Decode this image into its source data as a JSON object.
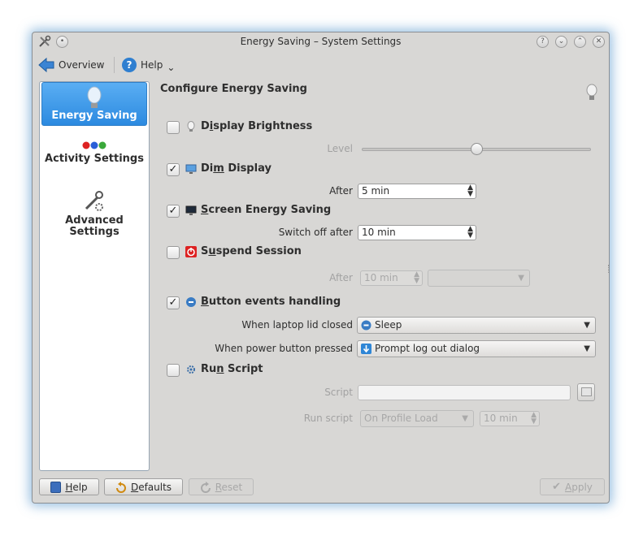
{
  "window": {
    "title": "Energy Saving – System Settings"
  },
  "toolbar": {
    "overview": "Overview",
    "help": "Help",
    "help_arrow": "⌄"
  },
  "sidebar": {
    "items": [
      {
        "label": "Energy Saving",
        "active": true
      },
      {
        "label": "Activity Settings"
      },
      {
        "label": "Advanced Settings"
      }
    ]
  },
  "main": {
    "heading": "Configure Energy Saving",
    "display_brightness": {
      "prefix": "D",
      "accel": "i",
      "rest": "splay Brightness",
      "checked": false,
      "level_label": "Level",
      "level": 0.5
    },
    "dim_display": {
      "prefix": "Di",
      "accel": "m",
      "rest": " Display",
      "checked": true,
      "after_label": "After",
      "after_value": "5 min"
    },
    "screen_energy": {
      "prefix": "",
      "accel": "S",
      "rest": "creen Energy Saving",
      "checked": true,
      "switch_label": "Switch off after",
      "switch_value": "10 min"
    },
    "suspend": {
      "prefix": "S",
      "accel": "u",
      "rest": "spend Session",
      "checked": false,
      "after_label": "After",
      "after_value": "10 min",
      "action": ""
    },
    "button_events": {
      "prefix": "",
      "accel": "B",
      "rest": "utton events handling",
      "checked": true,
      "lid_label": "When laptop lid closed",
      "lid_value": "Sleep",
      "power_label": "When power button pressed",
      "power_value": "Prompt log out dialog"
    },
    "run_script": {
      "prefix": "Ru",
      "accel": "n",
      "rest": " Script",
      "checked": false,
      "script_label": "Script",
      "script_value": "",
      "run_label": "Run script",
      "run_value": "On Profile Load",
      "run_time": "10 min"
    }
  },
  "buttons": {
    "help": {
      "accel": "H",
      "rest": "elp"
    },
    "defaults": {
      "accel": "D",
      "rest": "efaults"
    },
    "reset": {
      "accel": "R",
      "rest": "eset"
    },
    "apply": {
      "accel": "A",
      "rest": "pply"
    }
  },
  "colors": {
    "accent": "#2c8ae0",
    "window_bg": "#d8d7d5",
    "glow": "#468cc8"
  }
}
